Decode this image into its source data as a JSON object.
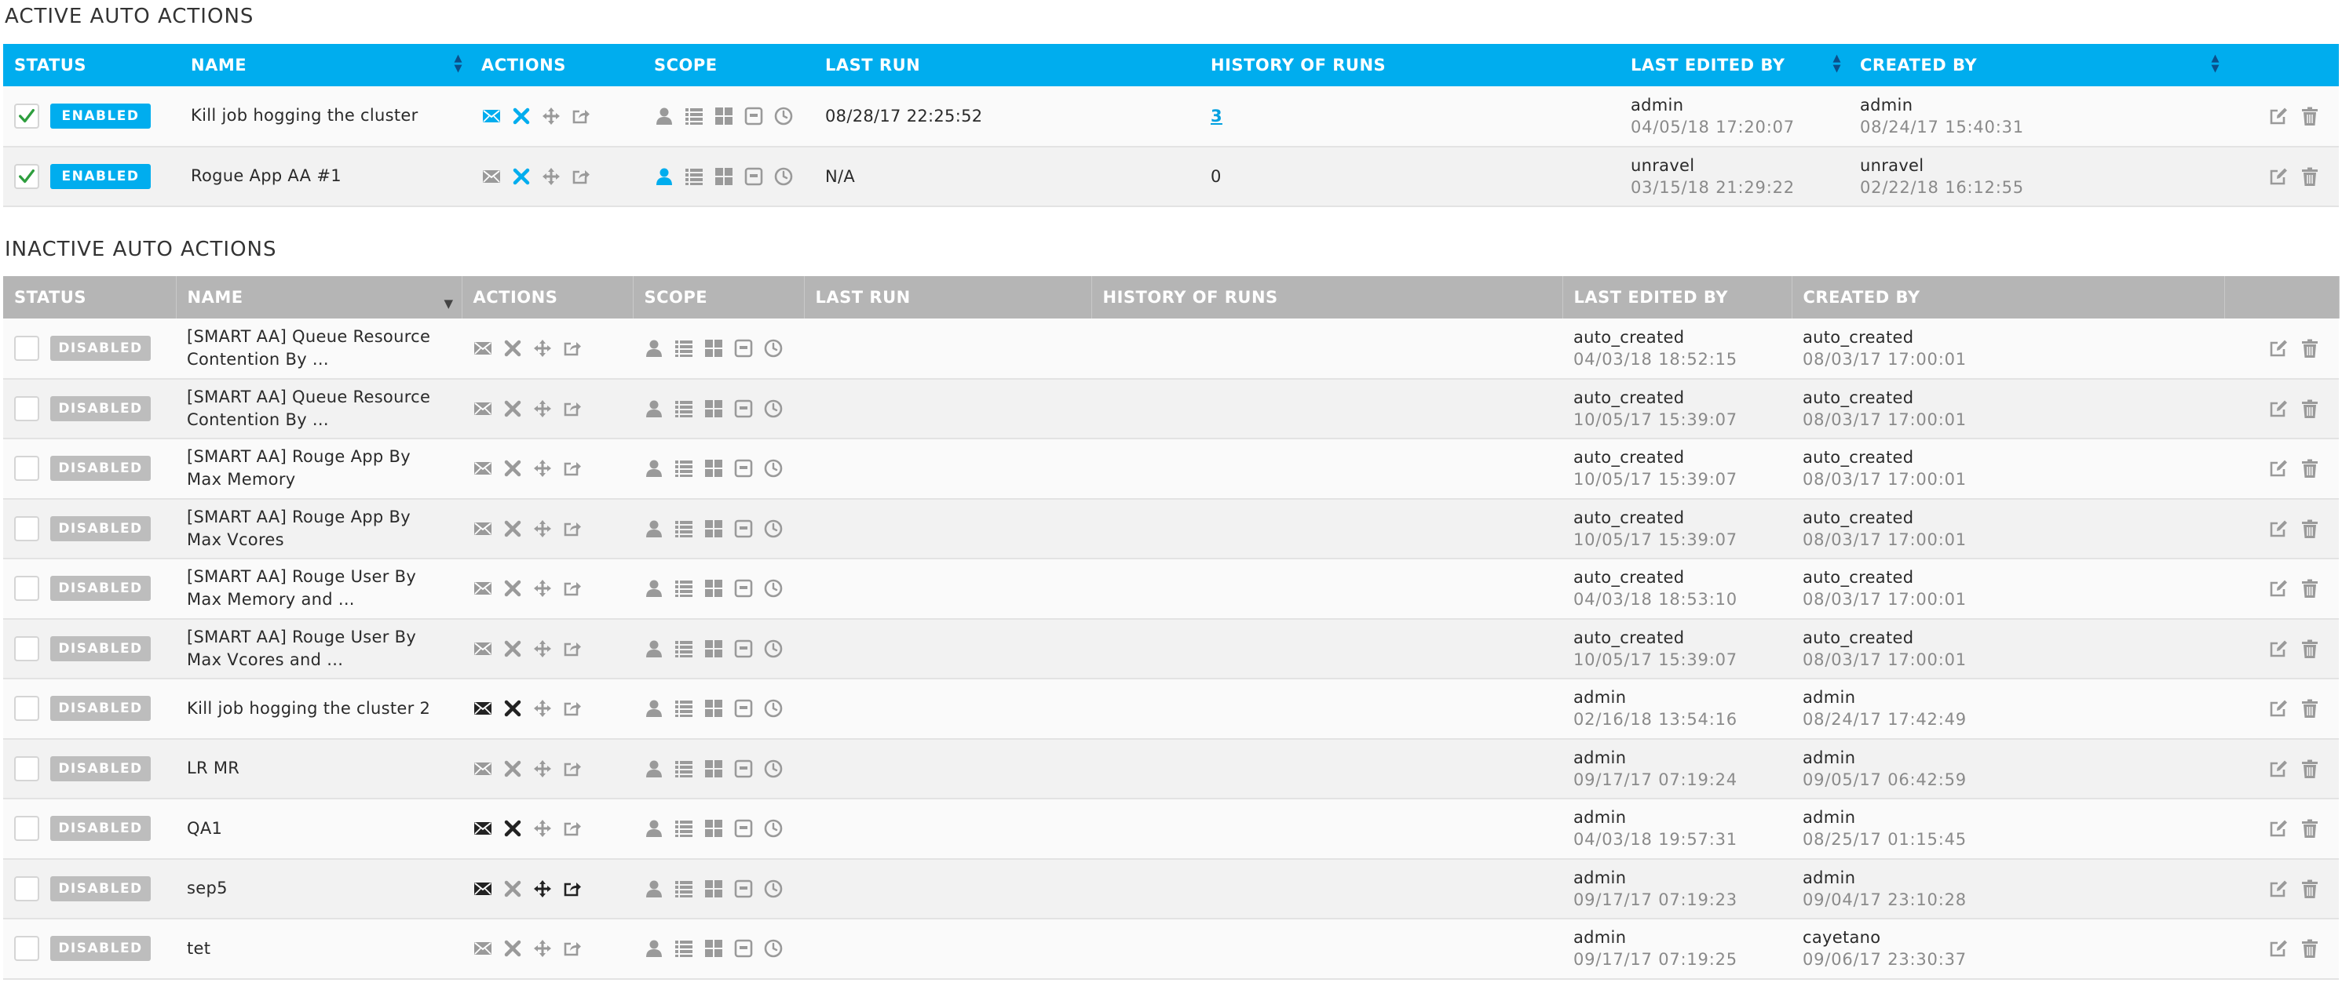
{
  "active": {
    "title": "ACTIVE AUTO ACTIONS",
    "columns": {
      "status": "STATUS",
      "name": "NAME",
      "actions": "ACTIONS",
      "scope": "SCOPE",
      "last_run": "LAST RUN",
      "history": "HISTORY OF RUNS",
      "last_edited_by": "LAST EDITED BY",
      "created_by": "CREATED BY"
    },
    "rows": [
      {
        "checked": true,
        "status": "ENABLED",
        "name": "Kill job hogging the cluster",
        "actions_highlight": [
          "email",
          "kill"
        ],
        "scope_highlight": [],
        "last_run": "08/28/17 22:25:52",
        "history": "3",
        "history_is_link": true,
        "edited_by": "admin",
        "edited_date": "04/05/18 17:20:07",
        "created_by": "admin",
        "created_date": "08/24/17 15:40:31"
      },
      {
        "checked": true,
        "status": "ENABLED",
        "name": "Rogue App AA #1",
        "actions_highlight": [
          "kill"
        ],
        "scope_highlight": [
          "user",
          "time"
        ],
        "last_run": "N/A",
        "history": "0",
        "history_is_link": false,
        "edited_by": "unravel",
        "edited_date": "03/15/18 21:29:22",
        "created_by": "unravel",
        "created_date": "02/22/18 16:12:55"
      }
    ]
  },
  "inactive": {
    "title": "INACTIVE AUTO ACTIONS",
    "columns": {
      "status": "STATUS",
      "name": "NAME",
      "actions": "ACTIONS",
      "scope": "SCOPE",
      "last_run": "LAST RUN",
      "history": "HISTORY OF RUNS",
      "last_edited_by": "LAST EDITED BY",
      "created_by": "CREATED BY"
    },
    "rows": [
      {
        "checked": false,
        "status": "DISABLED",
        "name": "[SMART AA] Queue Resource Contention By ...",
        "actions_dark": [],
        "edited_by": "auto_created",
        "edited_date": "04/03/18 18:52:15",
        "created_by": "auto_created",
        "created_date": "08/03/17 17:00:01"
      },
      {
        "checked": false,
        "status": "DISABLED",
        "name": "[SMART AA] Queue Resource Contention By ...",
        "actions_dark": [],
        "edited_by": "auto_created",
        "edited_date": "10/05/17 15:39:07",
        "created_by": "auto_created",
        "created_date": "08/03/17 17:00:01"
      },
      {
        "checked": false,
        "status": "DISABLED",
        "name": "[SMART AA] Rouge App By Max Memory",
        "actions_dark": [],
        "edited_by": "auto_created",
        "edited_date": "10/05/17 15:39:07",
        "created_by": "auto_created",
        "created_date": "08/03/17 17:00:01"
      },
      {
        "checked": false,
        "status": "DISABLED",
        "name": "[SMART AA] Rouge App By Max Vcores",
        "actions_dark": [],
        "edited_by": "auto_created",
        "edited_date": "10/05/17 15:39:07",
        "created_by": "auto_created",
        "created_date": "08/03/17 17:00:01"
      },
      {
        "checked": false,
        "status": "DISABLED",
        "name": "[SMART AA] Rouge User By Max Memory and ...",
        "actions_dark": [],
        "edited_by": "auto_created",
        "edited_date": "04/03/18 18:53:10",
        "created_by": "auto_created",
        "created_date": "08/03/17 17:00:01"
      },
      {
        "checked": false,
        "status": "DISABLED",
        "name": "[SMART AA] Rouge User By Max Vcores and ...",
        "actions_dark": [],
        "edited_by": "auto_created",
        "edited_date": "10/05/17 15:39:07",
        "created_by": "auto_created",
        "created_date": "08/03/17 17:00:01"
      },
      {
        "checked": false,
        "status": "DISABLED",
        "name": "Kill job hogging the cluster 2",
        "actions_dark": [
          "email",
          "kill"
        ],
        "edited_by": "admin",
        "edited_date": "02/16/18 13:54:16",
        "created_by": "admin",
        "created_date": "08/24/17 17:42:49"
      },
      {
        "checked": false,
        "status": "DISABLED",
        "name": "LR MR",
        "actions_dark": [],
        "edited_by": "admin",
        "edited_date": "09/17/17 07:19:24",
        "created_by": "admin",
        "created_date": "09/05/17 06:42:59"
      },
      {
        "checked": false,
        "status": "DISABLED",
        "name": "QA1",
        "actions_dark": [
          "email",
          "kill"
        ],
        "edited_by": "admin",
        "edited_date": "04/03/18 19:57:31",
        "created_by": "admin",
        "created_date": "08/25/17 01:15:45"
      },
      {
        "checked": false,
        "status": "DISABLED",
        "name": "sep5",
        "actions_dark": [
          "email",
          "move",
          "share"
        ],
        "edited_by": "admin",
        "edited_date": "09/17/17 07:19:23",
        "created_by": "admin",
        "created_date": "09/04/17 23:10:28"
      },
      {
        "checked": false,
        "status": "DISABLED",
        "name": "tet",
        "actions_dark": [],
        "edited_by": "admin",
        "edited_date": "09/17/17 07:19:25",
        "created_by": "cayetano",
        "created_date": "09/06/17 23:30:37"
      }
    ]
  },
  "colors": {
    "accent": "#00adee",
    "inactive_header": "#b5b5b5",
    "icon_muted": "#9a9a9a",
    "icon_dark": "#222222",
    "check_green": "#2e9e3e"
  },
  "icons": {
    "actions": [
      "email-icon",
      "kill-icon",
      "move-icon",
      "share-icon"
    ],
    "scope": [
      "user-icon",
      "list-icon",
      "grid-icon",
      "queue-icon",
      "clock-icon"
    ],
    "row_actions": [
      "edit-icon",
      "trash-icon"
    ]
  }
}
